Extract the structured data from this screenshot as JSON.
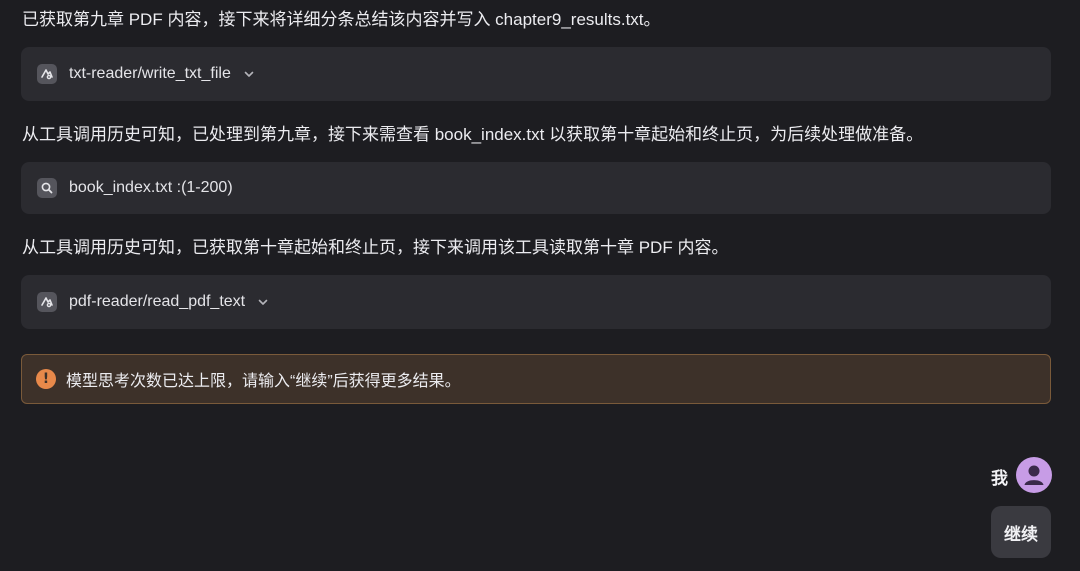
{
  "messages": {
    "m1": "已获取第九章 PDF 内容，接下来将详细分条总结该内容并写入 chapter9_results.txt。",
    "m2": "从工具调用历史可知，已处理到第九章，接下来需查看 book_index.txt 以获取第十章起始和终止页，为后续处理做准备。",
    "m3": "从工具调用历史可知，已获取第十章起始和终止页，接下来调用该工具读取第十章 PDF 内容。"
  },
  "tools": {
    "t1": {
      "label": "txt-reader/write_txt_file",
      "icon": "tool-icon"
    },
    "t2": {
      "label": "book_index.txt :(1-200)",
      "icon": "search-icon"
    },
    "t3": {
      "label": "pdf-reader/read_pdf_text",
      "icon": "tool-icon"
    }
  },
  "warning": {
    "text": "模型思考次数已达上限，请输入“继续”后获得更多结果。",
    "icon": "exclamation-icon",
    "accent": "#e8894a"
  },
  "user": {
    "name": "我",
    "message": "继续",
    "avatar_color": "#c79ce6"
  }
}
